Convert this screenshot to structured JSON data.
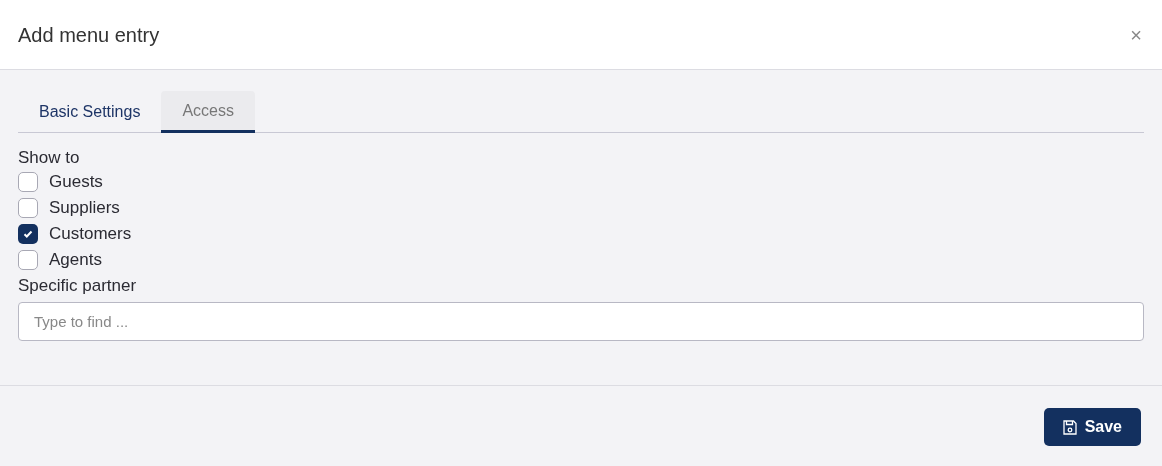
{
  "dialog": {
    "title": "Add menu entry",
    "close": "×"
  },
  "tabs": [
    {
      "label": "Basic Settings",
      "selected": false
    },
    {
      "label": "Access",
      "selected": true
    }
  ],
  "show_to": {
    "label": "Show to",
    "options": [
      {
        "label": "Guests",
        "checked": false
      },
      {
        "label": "Suppliers",
        "checked": false
      },
      {
        "label": "Customers",
        "checked": true
      },
      {
        "label": "Agents",
        "checked": false
      }
    ]
  },
  "specific_partner": {
    "label": "Specific partner",
    "placeholder": "Type to find ..."
  },
  "buttons": [
    {
      "label": "Save"
    }
  ]
}
